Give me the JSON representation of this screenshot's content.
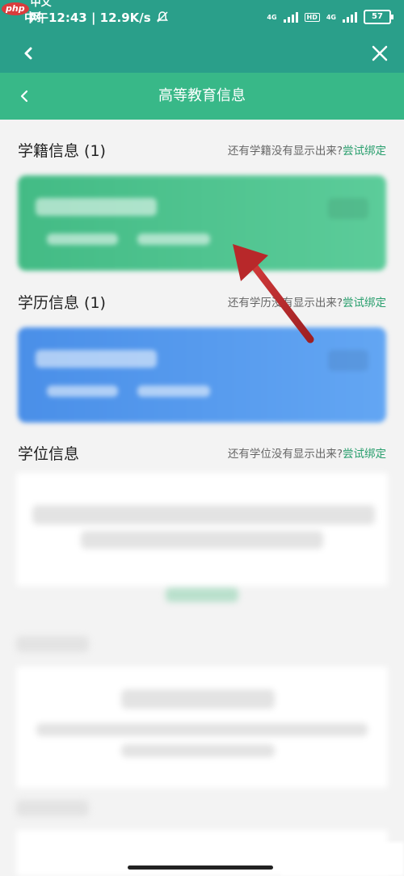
{
  "status_bar": {
    "time_text": "中午12:43 | 12.9K/s",
    "network_1": "4G",
    "hd_label": "HD",
    "network_2": "4G",
    "battery": "57"
  },
  "watermark_logo": {
    "php": "php",
    "cn": "中文网"
  },
  "header": {
    "title": "高等教育信息"
  },
  "sections": [
    {
      "title": "学籍信息 (1)",
      "hint": "还有学籍没有显示出来?",
      "link": "尝试绑定"
    },
    {
      "title": "学历信息 (1)",
      "hint": "还有学历没有显示出来?",
      "link": "尝试绑定"
    },
    {
      "title": "学位信息",
      "hint": "还有学位没有显示出来?",
      "link": "尝试绑定"
    }
  ],
  "colors": {
    "toolbar": "#2a9f8a",
    "header": "#38b888",
    "accent_link": "#2a9f6e",
    "card_green": "#43bb85",
    "card_blue": "#4a8fe8",
    "arrow": "#b8282a"
  }
}
